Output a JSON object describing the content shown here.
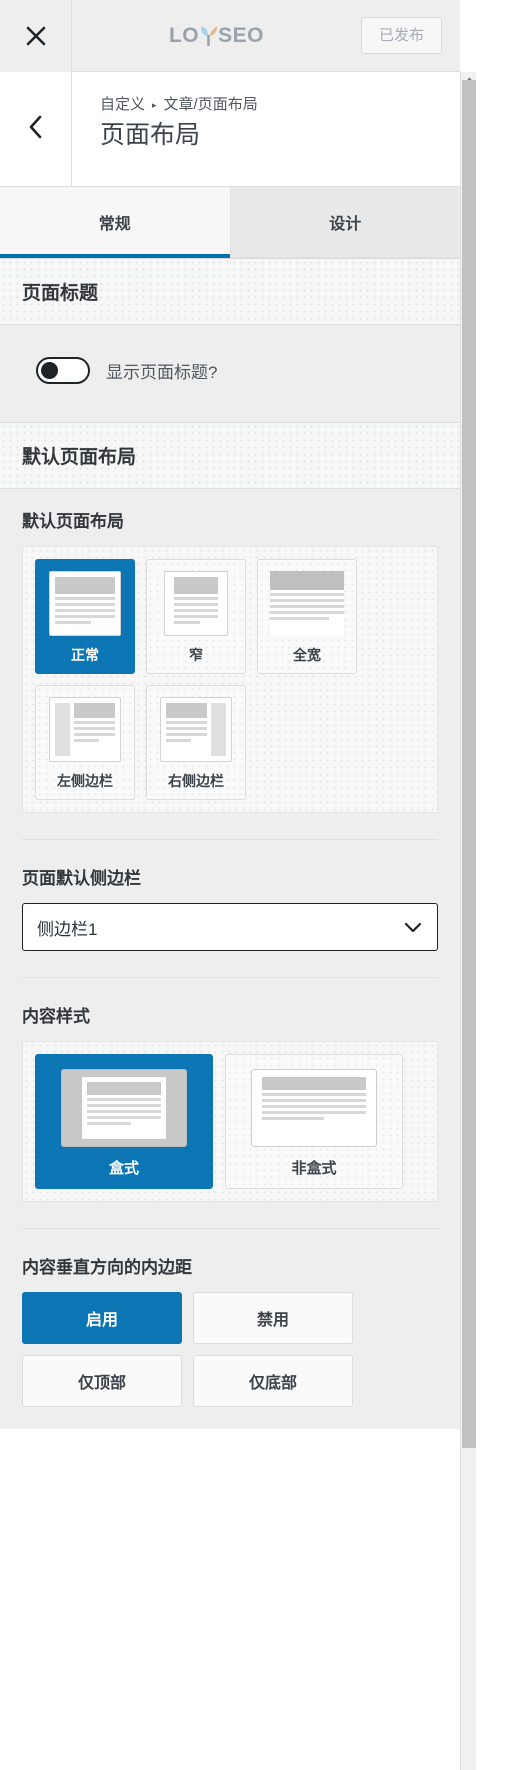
{
  "header": {
    "close_icon": "close-icon",
    "brand_left": "LO",
    "brand_right": "SEO",
    "publish_button": "已发布"
  },
  "breadcrumb": {
    "back_icon": "chevron-left-icon",
    "parent": "自定义",
    "separator": "▸",
    "current": "文章/页面布局",
    "title": "页面布局"
  },
  "tabs": [
    {
      "label": "常规",
      "active": true
    },
    {
      "label": "设计",
      "active": false
    }
  ],
  "sections": {
    "page_title": {
      "heading": "页面标题",
      "toggle_label": "显示页面标题?",
      "toggle_state": "off"
    },
    "default_page_layout": {
      "heading": "默认页面布局",
      "field_label": "默认页面布局",
      "options": [
        {
          "label": "正常",
          "selected": true,
          "thumb": "normal"
        },
        {
          "label": "窄",
          "selected": false,
          "thumb": "narrow"
        },
        {
          "label": "全宽",
          "selected": false,
          "thumb": "fullwidth"
        },
        {
          "label": "左侧边栏",
          "selected": false,
          "thumb": "left-sidebar"
        },
        {
          "label": "右侧边栏",
          "selected": false,
          "thumb": "right-sidebar"
        }
      ],
      "sidebar_field_label": "页面默认侧边栏",
      "sidebar_select_value": "侧边栏1",
      "content_style_label": "内容样式",
      "content_style_options": [
        {
          "label": "盒式",
          "selected": true,
          "thumb": "boxed"
        },
        {
          "label": "非盒式",
          "selected": false,
          "thumb": "unboxed"
        }
      ],
      "padding_label": "内容垂直方向的内边距",
      "padding_options": [
        {
          "label": "启用",
          "selected": true
        },
        {
          "label": "禁用",
          "selected": false
        },
        {
          "label": "仅顶部",
          "selected": false
        },
        {
          "label": "仅底部",
          "selected": false
        }
      ]
    }
  },
  "colors": {
    "accent": "#0c76b4",
    "tab_underline": "#0073aa",
    "panel_bg": "#eeeeee",
    "header_bg": "#eeeeee",
    "text_dark": "#32373c",
    "text_muted": "#50575e",
    "logo_blue": "#a9d4ea",
    "logo_tan": "#e0b98c"
  }
}
